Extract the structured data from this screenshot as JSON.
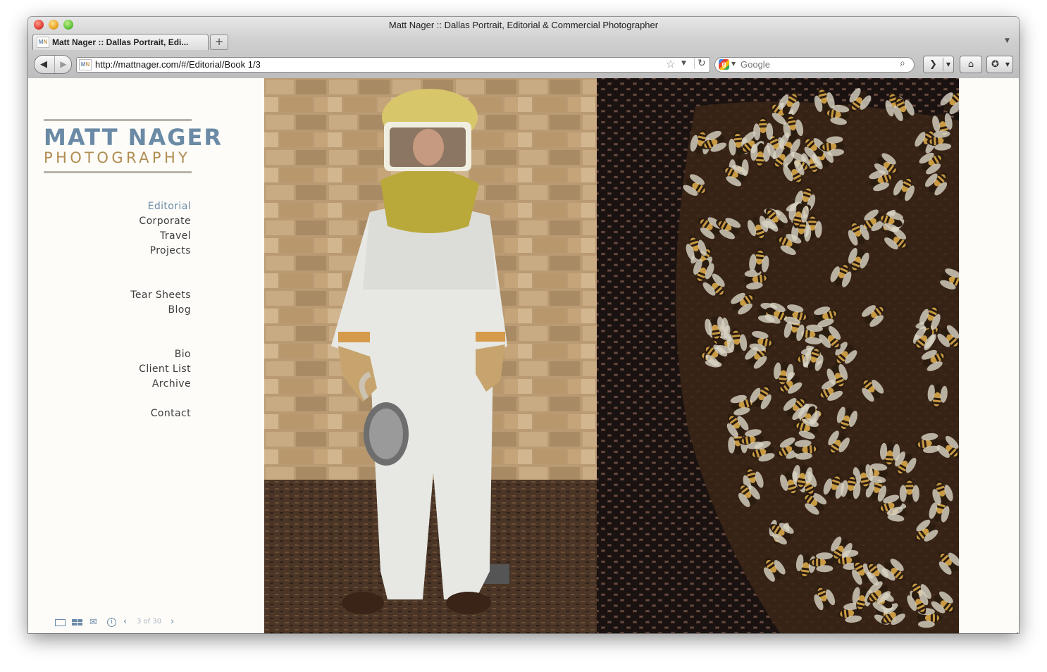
{
  "window": {
    "title": "Matt Nager :: Dallas Portrait, Editorial & Commercial Photographer"
  },
  "tabs": [
    {
      "label": "Matt Nager :: Dallas Portrait, Edi...",
      "favicon": "MN"
    }
  ],
  "toolbar": {
    "new_tab": "+",
    "url": "http://mattnager.com/#/Editorial/Book 1/3",
    "search_placeholder": "Google",
    "search_engine_logo": "g"
  },
  "site": {
    "logo": {
      "line1": "MATT NAGER",
      "line2": "PHOTOGRAPHY",
      "color_primary": "#6a8aa6",
      "color_secondary": "#b08d52"
    },
    "nav_primary": [
      {
        "label": "Editorial",
        "active": true
      },
      {
        "label": "Corporate",
        "active": false
      },
      {
        "label": "Travel",
        "active": false
      },
      {
        "label": "Projects",
        "active": false
      }
    ],
    "nav_secondary": [
      {
        "label": "Tear Sheets"
      },
      {
        "label": "Blog"
      }
    ],
    "nav_info": [
      {
        "label": "Bio"
      },
      {
        "label": "Client List"
      },
      {
        "label": "Archive"
      }
    ],
    "nav_contact": {
      "label": "Contact"
    },
    "gallery": {
      "counter": "3 of 30",
      "icons": [
        "single-view-icon",
        "thumbnail-grid-icon",
        "email-share-icon",
        "info-icon",
        "previous-arrow-icon",
        "next-arrow-icon"
      ]
    }
  }
}
